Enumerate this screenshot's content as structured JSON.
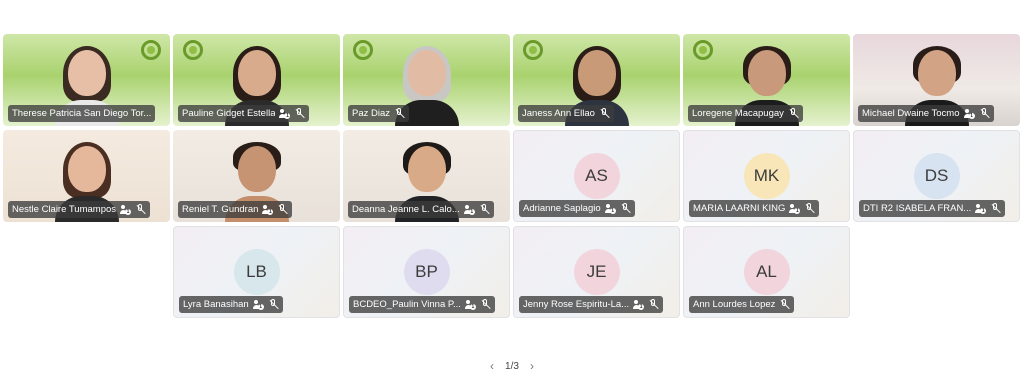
{
  "participants": [
    {
      "name": "Therese Patricia San Diego Tor...",
      "initials": "",
      "avatar_color": "",
      "mic_muted": false,
      "has_people_icon": false
    },
    {
      "name": "Pauline Gidget Estella",
      "initials": "",
      "avatar_color": "",
      "mic_muted": true,
      "has_people_icon": true
    },
    {
      "name": "Paz Diaz",
      "initials": "",
      "avatar_color": "",
      "mic_muted": true,
      "has_people_icon": false
    },
    {
      "name": "Janess Ann Ellao",
      "initials": "",
      "avatar_color": "",
      "mic_muted": true,
      "has_people_icon": false
    },
    {
      "name": "Loregene Macapugay",
      "initials": "",
      "avatar_color": "",
      "mic_muted": true,
      "has_people_icon": false
    },
    {
      "name": "Michael Dwaine Tocmo",
      "initials": "",
      "avatar_color": "",
      "mic_muted": true,
      "has_people_icon": true
    },
    {
      "name": "Nestle Claire Tumampos",
      "initials": "",
      "avatar_color": "",
      "mic_muted": true,
      "has_people_icon": true
    },
    {
      "name": "Reniel T. Gundran",
      "initials": "",
      "avatar_color": "",
      "mic_muted": true,
      "has_people_icon": true
    },
    {
      "name": "Deanna Jeanne L. Calo...",
      "initials": "",
      "avatar_color": "",
      "mic_muted": true,
      "has_people_icon": true
    },
    {
      "name": "Adrianne Saplagio",
      "initials": "AS",
      "avatar_color": "#f2d4dc",
      "mic_muted": true,
      "has_people_icon": true
    },
    {
      "name": "MARIA LAARNI KING",
      "initials": "MK",
      "avatar_color": "#f8e6b8",
      "mic_muted": true,
      "has_people_icon": true
    },
    {
      "name": "DTI R2 ISABELA FRAN...",
      "initials": "DS",
      "avatar_color": "#d7e3f0",
      "mic_muted": true,
      "has_people_icon": true
    },
    {
      "name": "Lyra Banasihan",
      "initials": "LB",
      "avatar_color": "#d7e7ec",
      "mic_muted": true,
      "has_people_icon": true
    },
    {
      "name": "BCDEO_Paulin Vinna P...",
      "initials": "BP",
      "avatar_color": "#e0dcef",
      "mic_muted": true,
      "has_people_icon": true
    },
    {
      "name": "Jenny Rose Espiritu-La...",
      "initials": "JE",
      "avatar_color": "#f2d4dc",
      "mic_muted": true,
      "has_people_icon": true
    },
    {
      "name": "Ann Lourdes Lopez",
      "initials": "AL",
      "avatar_color": "#f2d4dc",
      "mic_muted": true,
      "has_people_icon": false
    }
  ],
  "pager": {
    "label": "1/3",
    "prev_icon": "chevron-left-icon",
    "next_icon": "chevron-right-icon"
  }
}
